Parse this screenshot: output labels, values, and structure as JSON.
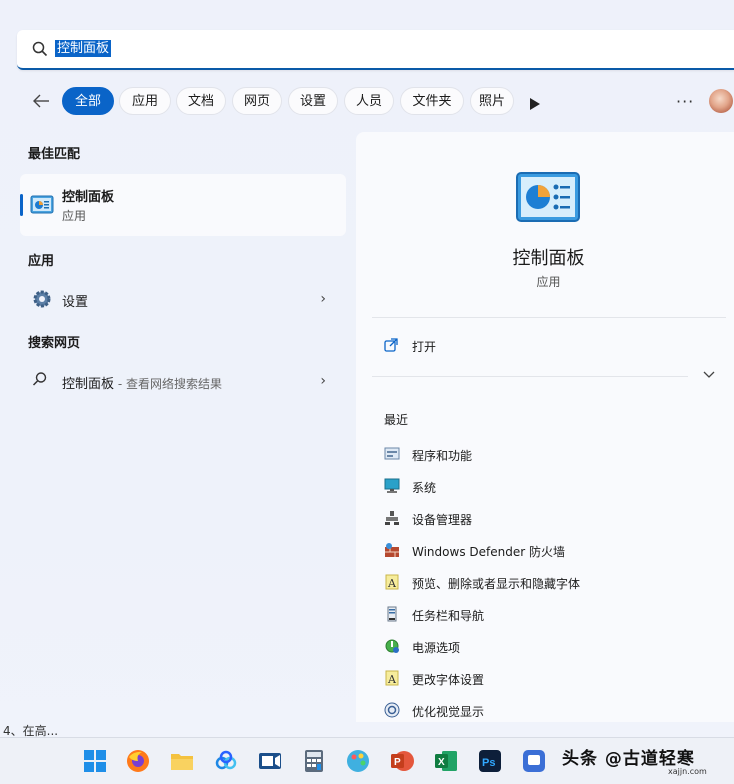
{
  "search": {
    "query": "控制面板"
  },
  "filters": [
    "全部",
    "应用",
    "文档",
    "网页",
    "设置",
    "人员",
    "文件夹",
    "照片"
  ],
  "more_label": "···",
  "left": {
    "best_match_heading": "最佳匹配",
    "best_match": {
      "title": "控制面板",
      "subtitle": "应用"
    },
    "apps_heading": "应用",
    "apps": [
      {
        "label": "设置"
      }
    ],
    "web_heading": "搜索网页",
    "web": {
      "label": "控制面板",
      "sub": " - 查看网络搜索结果"
    },
    "chevron": "›"
  },
  "right": {
    "title": "控制面板",
    "subtitle": "应用",
    "open_label": "打开",
    "recent_heading": "最近",
    "recent": [
      {
        "label": "程序和功能",
        "icon": "programs-icon"
      },
      {
        "label": "系统",
        "icon": "system-monitor-icon"
      },
      {
        "label": "设备管理器",
        "icon": "device-manager-icon"
      },
      {
        "label": "Windows Defender 防火墙",
        "icon": "firewall-icon"
      },
      {
        "label": "预览、删除或者显示和隐藏字体",
        "icon": "font-icon"
      },
      {
        "label": "任务栏和导航",
        "icon": "taskbar-icon"
      },
      {
        "label": "电源选项",
        "icon": "power-options-icon"
      },
      {
        "label": "更改字体设置",
        "icon": "font-settings-icon"
      },
      {
        "label": "优化视觉显示",
        "icon": "ease-of-access-icon"
      }
    ]
  },
  "status_text": "4、在高...",
  "watermark": {
    "text": "头条 @古道轻寒",
    "small": "xajjn.com"
  },
  "colors": {
    "accent": "#0a64c8",
    "background": "#eef1fa",
    "panel": "#f9fafd"
  }
}
